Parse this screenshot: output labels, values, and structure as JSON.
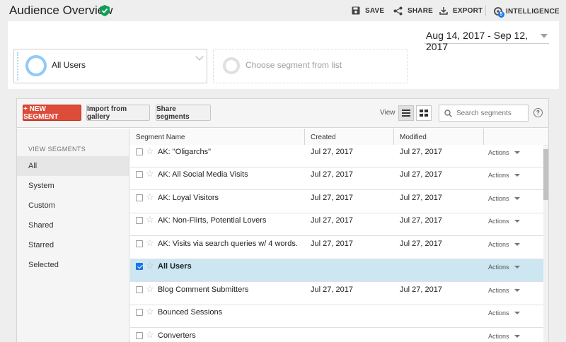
{
  "header": {
    "title": "Audience Overview",
    "save": "SAVE",
    "share": "SHARE",
    "export": "EXPORT",
    "intelligence": "INTELLIGENCE",
    "intelligence_badge": "5"
  },
  "panel": {
    "date_range": "Aug 14, 2017 - Sep 12, 2017",
    "segment_selected": "All Users",
    "segment_placeholder": "Choose segment from list"
  },
  "builder": {
    "new_segment": "+ NEW SEGMENT",
    "import_gallery": "Import from gallery",
    "share_segments": "Share segments",
    "view_label": "View",
    "search_placeholder": "Search segments",
    "help": "?"
  },
  "sidebar": {
    "heading": "VIEW SEGMENTS",
    "items": [
      {
        "label": "All"
      },
      {
        "label": "System"
      },
      {
        "label": "Custom"
      },
      {
        "label": "Shared"
      },
      {
        "label": "Starred"
      },
      {
        "label": "Selected"
      }
    ]
  },
  "table": {
    "columns": [
      "Segment Name",
      "Created",
      "Modified"
    ],
    "actions_label": "Actions",
    "rows": [
      {
        "name": "AK: \"Oligarchs\"",
        "created": "Jul 27, 2017",
        "modified": "Jul 27, 2017",
        "checked": false
      },
      {
        "name": "AK: All Social Media Visits",
        "created": "Jul 27, 2017",
        "modified": "Jul 27, 2017",
        "checked": false
      },
      {
        "name": "AK: Loyal Visitors",
        "created": "Jul 27, 2017",
        "modified": "Jul 27, 2017",
        "checked": false
      },
      {
        "name": "AK: Non-Flirts, Potential Lovers",
        "created": "Jul 27, 2017",
        "modified": "Jul 27, 2017",
        "checked": false
      },
      {
        "name": "AK: Visits via search queries w/ 4 words.",
        "created": "Jul 27, 2017",
        "modified": "Jul 27, 2017",
        "checked": false
      },
      {
        "name": "All Users",
        "created": "",
        "modified": "",
        "checked": true
      },
      {
        "name": "Blog Comment Submitters",
        "created": "Jul 27, 2017",
        "modified": "Jul 27, 2017",
        "checked": false
      },
      {
        "name": "Bounced Sessions",
        "created": "",
        "modified": "",
        "checked": false
      },
      {
        "name": "Converters",
        "created": "",
        "modified": "",
        "checked": false
      }
    ]
  },
  "colors": {
    "accent_red": "#dd4b39",
    "selected_row": "#cce6f2",
    "verified_green": "#0f9d58",
    "checkbox_blue": "#1a73e8"
  }
}
